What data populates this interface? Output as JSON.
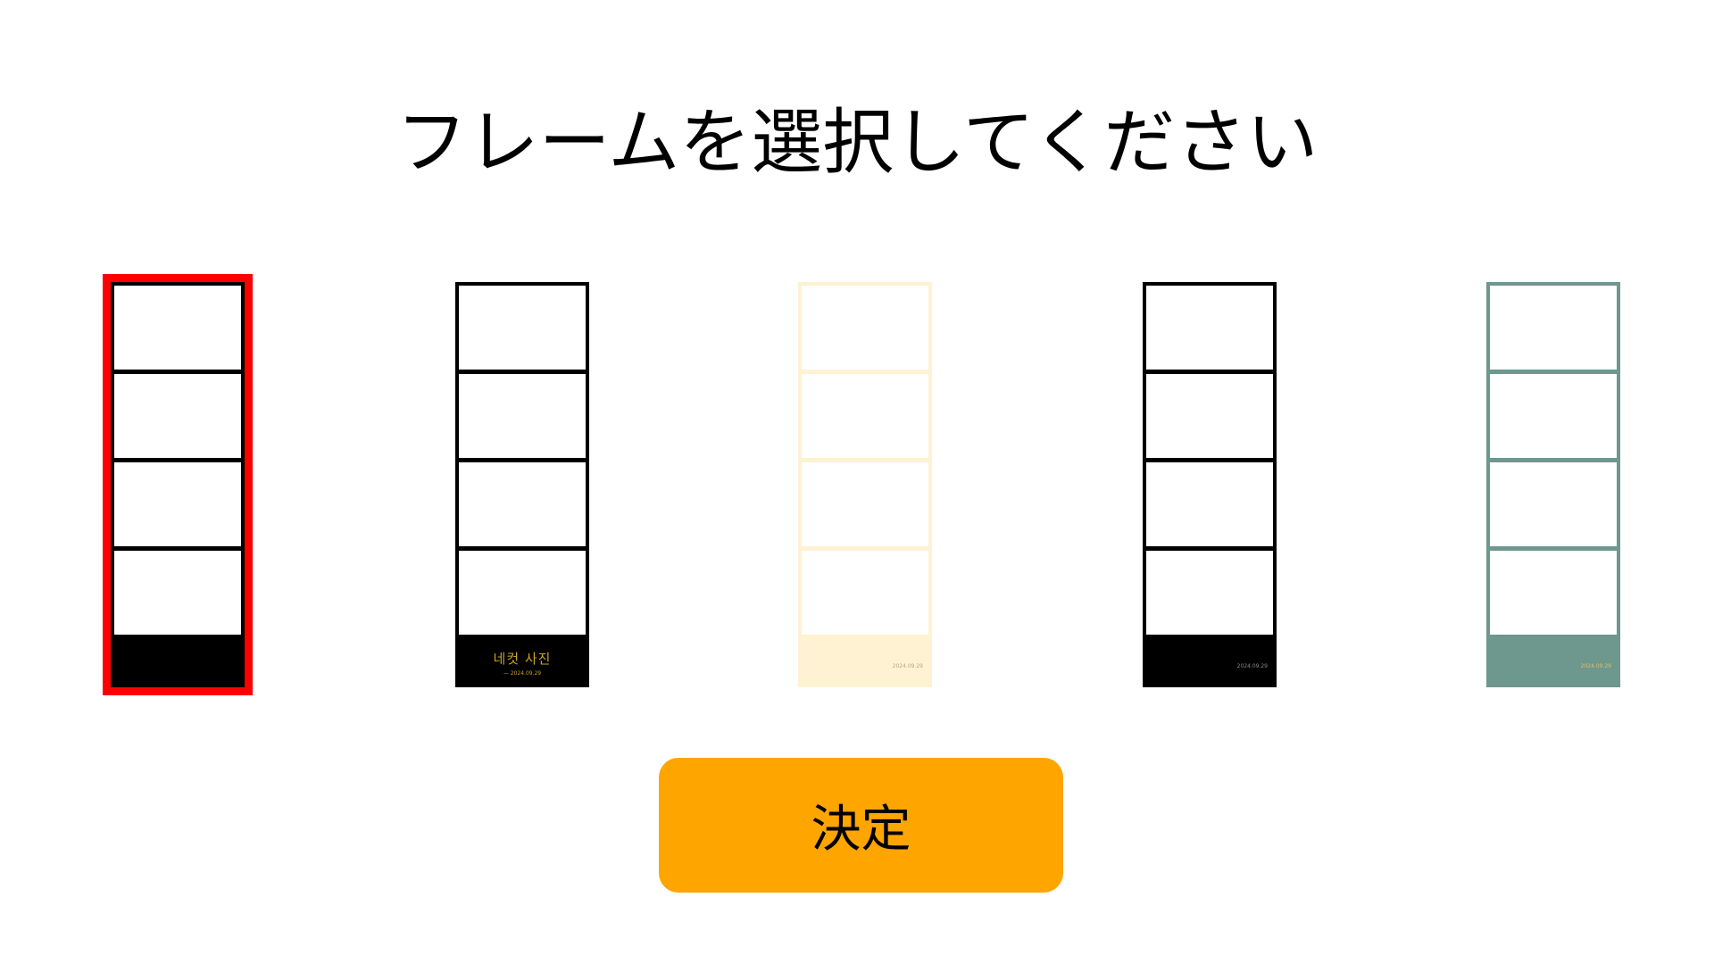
{
  "title": "フレームを選択してください",
  "frames": [
    {
      "name": "frame-black-plain",
      "border_color": "#000000",
      "footer_color": "#000000",
      "footer_title": "",
      "footer_date": "",
      "selected": true
    },
    {
      "name": "frame-black-titled",
      "border_color": "#000000",
      "footer_color": "#000000",
      "footer_title": "네컷 사진",
      "footer_date": "— 2024.09.29",
      "date_color": "#c9a227",
      "selected": false
    },
    {
      "name": "frame-cream",
      "border_color": "#fff2d3",
      "footer_color": "#fff2d3",
      "footer_title": "",
      "footer_date": "2024.09.29",
      "date_color": "#b8a67a",
      "selected": false
    },
    {
      "name": "frame-black-dated",
      "border_color": "#000000",
      "footer_color": "#000000",
      "footer_title": "",
      "footer_date": "2024.09.29",
      "date_color": "#8a8a8a",
      "selected": false
    },
    {
      "name": "frame-sage",
      "border_color": "#6e978d",
      "footer_color": "#6e978d",
      "footer_title": "",
      "footer_date": "2024.09.29",
      "date_color": "#e0c060",
      "selected": false
    }
  ],
  "decide_button": {
    "label": "決定",
    "color": "#ffa500"
  },
  "selection_color": "#ff0000"
}
